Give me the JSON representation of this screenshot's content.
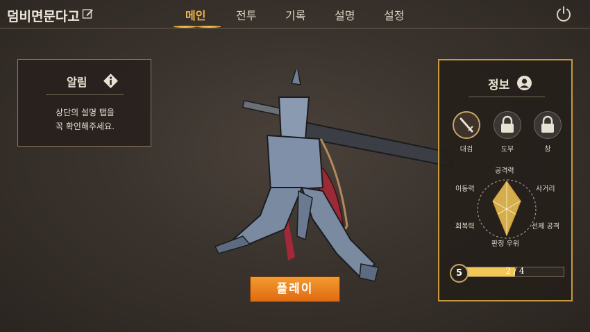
{
  "header": {
    "title": "덤비면문다고",
    "tabs": [
      {
        "label": "메인",
        "active": true
      },
      {
        "label": "전투",
        "active": false
      },
      {
        "label": "기록",
        "active": false
      },
      {
        "label": "설명",
        "active": false
      },
      {
        "label": "설정",
        "active": false
      }
    ]
  },
  "notice": {
    "title": "알림",
    "lines": [
      "상단의 설명 탭을",
      "꼭 확인해주세요."
    ]
  },
  "info_panel": {
    "title": "정보",
    "weapons": [
      {
        "label": "대검",
        "icon": "sword-icon",
        "locked": false,
        "selected": true
      },
      {
        "label": "도부",
        "icon": "lock-icon",
        "locked": true,
        "selected": false
      },
      {
        "label": "창",
        "icon": "lock-icon",
        "locked": true,
        "selected": false
      }
    ],
    "stats": [
      {
        "label": "공격력",
        "value": 0.95
      },
      {
        "label": "사거리",
        "value": 0.55
      },
      {
        "label": "선제 공격",
        "value": 0.35
      },
      {
        "label": "판정 우위",
        "value": 0.9
      },
      {
        "label": "회복력",
        "value": 0.35
      },
      {
        "label": "이동력",
        "value": 0.55
      }
    ],
    "level": "5",
    "xp_current": "2",
    "xp_max": "4",
    "xp_fraction": 0.5,
    "xp_separator": "/"
  },
  "play_button": "플레이",
  "colors": {
    "accent": "#f1b64b",
    "panel_border": "#c79a3f",
    "play_button": "#ee8420",
    "radar_fill": "#f3c756"
  }
}
